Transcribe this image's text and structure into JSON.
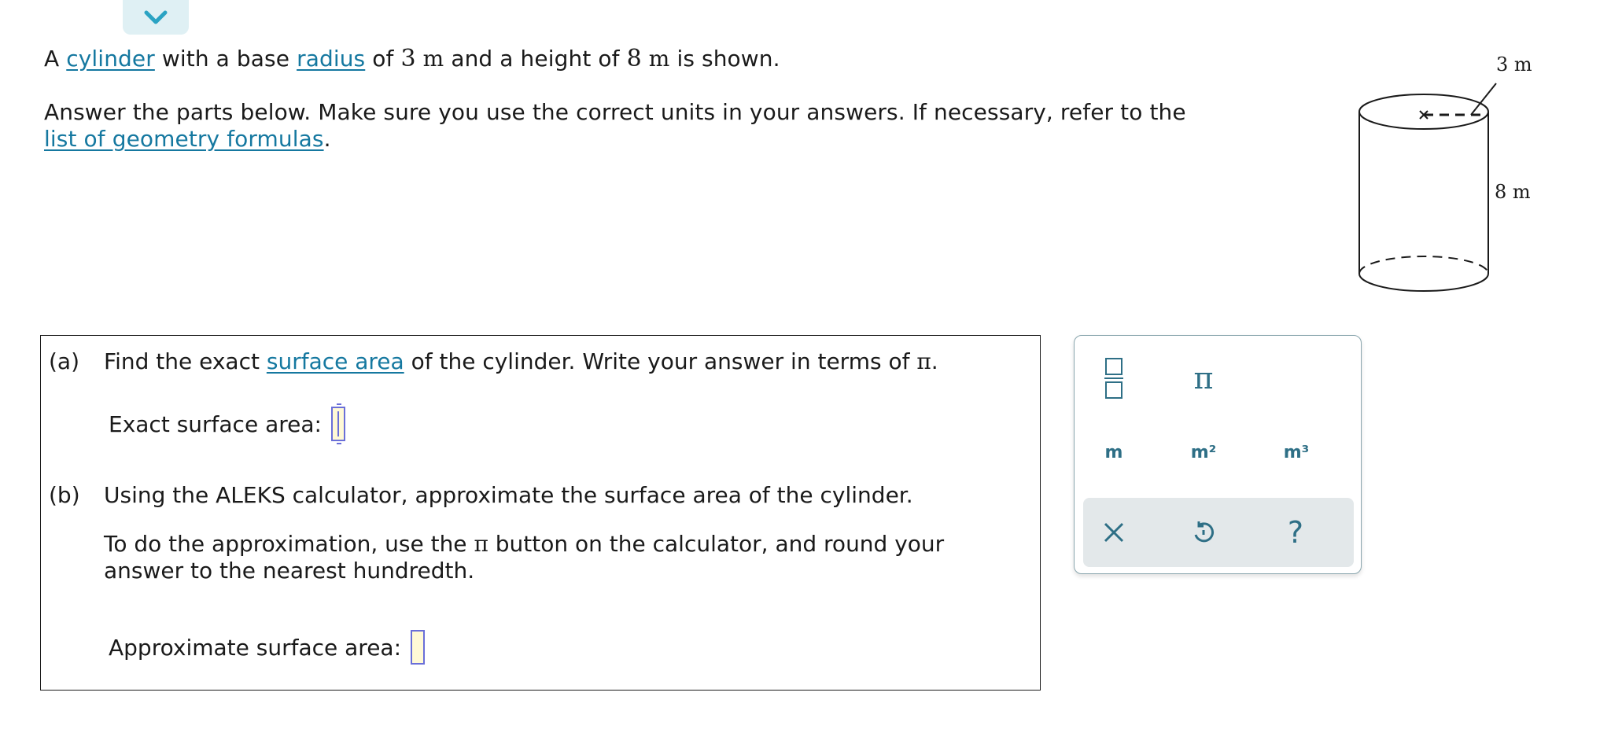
{
  "intro": {
    "sentence1": {
      "pre": "A ",
      "link_cylinder": "cylinder",
      "mid1": " with a base ",
      "link_radius": "radius",
      "mid2": " of ",
      "radius_value": "3",
      "radius_unit": "m",
      "mid3": " and a height of ",
      "height_value": "8",
      "height_unit": "m",
      "post": " is shown."
    },
    "sentence2": {
      "text": "Answer the parts below. Make sure you use the correct units in your answers. If necessary, refer to the",
      "link_formulas": "list of geometry formulas",
      "post": "."
    }
  },
  "figure": {
    "radius_label": "3 m",
    "height_label": "8 m"
  },
  "part_a": {
    "label": "(a)",
    "text_pre": "Find the exact ",
    "link_surface_area": "surface area",
    "text_post": " of the cylinder. Write your answer in terms of ",
    "pi_symbol": "π",
    "period": ".",
    "answer_label": "Exact surface area:",
    "answer_value": ""
  },
  "part_b": {
    "label": "(b)",
    "text": "Using the ALEKS calculator, approximate the surface area of the cylinder.",
    "instr_pre": "To do the approximation, use the ",
    "pi_symbol": "π",
    "instr_post": " button on the calculator, and round your answer to the nearest hundredth.",
    "answer_label": "Approximate surface area:",
    "answer_value": ""
  },
  "calculator": {
    "keys": {
      "fraction": "fraction-icon",
      "pi": "π",
      "unit_m": "m",
      "unit_m2": "m²",
      "unit_m3": "m³",
      "clear": "×",
      "undo": "undo-icon",
      "help": "?"
    },
    "colors": {
      "key": "#2e6f86",
      "action_bg": "#e3e8ea",
      "border": "#8aa6ae"
    }
  },
  "colors": {
    "link": "#1578a0",
    "answer_border": "#6a6fd8",
    "answer_fill": "#fff9d6",
    "collapse_tab": "#dff0f4",
    "collapse_chevron": "#2aa3c3"
  }
}
